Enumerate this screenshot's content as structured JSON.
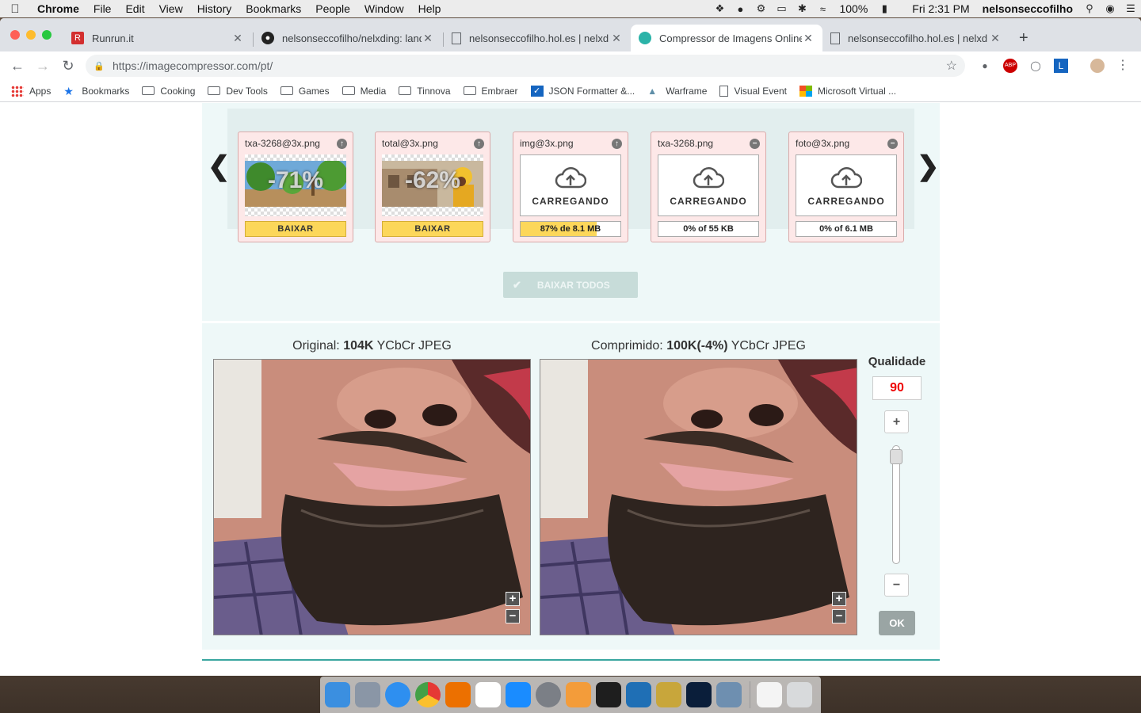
{
  "menubar": {
    "app": "Chrome",
    "items": [
      "File",
      "Edit",
      "View",
      "History",
      "Bookmarks",
      "People",
      "Window",
      "Help"
    ],
    "battery": "100%",
    "clock": "Fri 2:31 PM",
    "user": "nelsonseccofilho"
  },
  "tabs": [
    {
      "title": "Runrun.it",
      "icon": "runrun-icon"
    },
    {
      "title": "nelsonseccofilho/nelxding: land",
      "icon": "github-icon"
    },
    {
      "title": "nelsonseccofilho.hol.es | nelxd",
      "icon": "page-icon"
    },
    {
      "title": "Compressor de Imagens Online",
      "icon": "compressor-icon",
      "active": true
    },
    {
      "title": "nelsonseccofilho.hol.es | nelxd",
      "icon": "page-icon"
    }
  ],
  "address": {
    "url": "https://imagecompressor.com/pt/"
  },
  "bookmarks": [
    "Apps",
    "Bookmarks",
    "Cooking",
    "Dev Tools",
    "Games",
    "Media",
    "Tinnova",
    "Embraer",
    "JSON Formatter &...",
    "Warframe",
    "Visual Event",
    "Microsoft Virtual ..."
  ],
  "files": [
    {
      "name": "txa-3268@3x.png",
      "state": "done",
      "percent": "-71%",
      "button": "BAIXAR"
    },
    {
      "name": "total@3x.png",
      "state": "done",
      "percent": "-62%",
      "button": "BAIXAR"
    },
    {
      "name": "img@3x.png",
      "state": "uploading",
      "label": "CARREGANDO",
      "progress": "87% de 8.1 MB",
      "progress_fraction": 0.76
    },
    {
      "name": "txa-3268.png",
      "state": "queued",
      "label": "CARREGANDO",
      "progress": "0% of 55 KB",
      "progress_fraction": 0
    },
    {
      "name": "foto@3x.png",
      "state": "queued",
      "label": "CARREGANDO",
      "progress": "0% of 6.1 MB",
      "progress_fraction": 0
    }
  ],
  "download_all": "BAIXAR TODOS",
  "comparison": {
    "original_prefix": "Original: ",
    "original_size": "104K",
    "original_format": " YCbCr JPEG",
    "compressed_prefix": "Comprimido: ",
    "compressed_size": "100K(-4%)",
    "compressed_format": " YCbCr JPEG"
  },
  "quality": {
    "label": "Qualidade",
    "value": "90",
    "ok": "OK"
  }
}
